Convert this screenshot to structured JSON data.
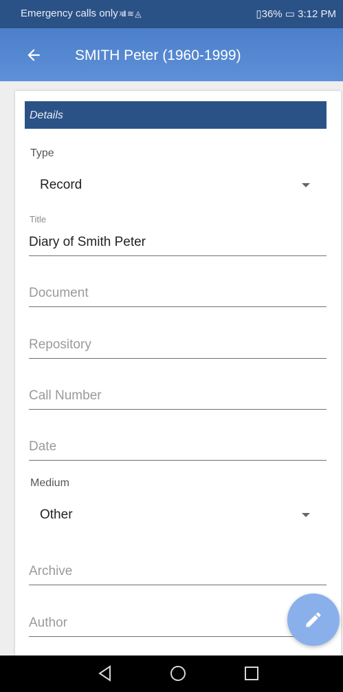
{
  "status_bar": {
    "left_text": "Emergency calls only",
    "signal_icons": "ᵡıll ≋ ◬",
    "right_text": "▯36% ▭ 3:12 PM"
  },
  "app_bar": {
    "title": "SMITH Peter (1960-1999)",
    "back_icon": "arrow-left"
  },
  "details": {
    "section_title": "Details",
    "type_label": "Type",
    "type_value": "Record",
    "title_label": "Title",
    "title_value": "Diary of Smith Peter",
    "document_placeholder": "Document",
    "repository_placeholder": "Repository",
    "call_number_placeholder": "Call Number",
    "date_placeholder": "Date",
    "medium_label": "Medium",
    "medium_value": "Other",
    "archive_placeholder": "Archive",
    "author_placeholder": "Author"
  },
  "fab": {
    "icon": "pencil"
  },
  "nav": {
    "back": "triangle",
    "home": "circle",
    "recents": "square"
  },
  "colors": {
    "status_bar": "#2b5286",
    "app_bar": "#4b7fca",
    "section_header": "#2b5286",
    "fab": "#8ab0ec"
  }
}
